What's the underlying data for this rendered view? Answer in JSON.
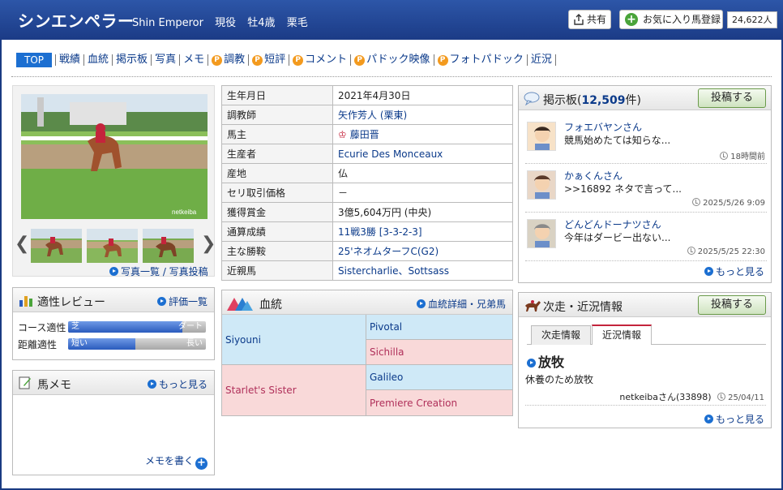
{
  "header": {
    "name": "シンエンペラー",
    "english_name": "Shin Emperor",
    "status": "現役",
    "sex_age": "牡4歳",
    "color": "栗毛",
    "share_label": "共有",
    "favorite_label": "お気に入り馬登録",
    "favorite_count": "24,622人"
  },
  "nav": {
    "top": "TOP",
    "items": [
      "戦績",
      "血統",
      "掲示板",
      "写真",
      "メモ",
      "調教",
      "短評",
      "コメント",
      "パドック映像",
      "フォトパドック",
      "近況"
    ],
    "premium_flags": [
      false,
      false,
      false,
      false,
      false,
      true,
      true,
      true,
      true,
      true,
      false
    ],
    "premium_mark": "P"
  },
  "photos": {
    "watermark": "netkeiba",
    "list_link": "写真一覧 / 写真投稿"
  },
  "aptitude": {
    "title": "適性レビュー",
    "link": "評価一覧",
    "rows": [
      {
        "label": "コース適性",
        "left": "芝",
        "right": "ダート",
        "value": 0.83
      },
      {
        "label": "距離適性",
        "left": "短い",
        "right": "長い",
        "value": 0.49
      }
    ]
  },
  "memo": {
    "title": "馬メモ",
    "link": "もっと見る",
    "write": "メモを書く"
  },
  "profile": [
    {
      "key": "生年月日",
      "value": "2021年4月30日",
      "link": false
    },
    {
      "key": "調教師",
      "value": "矢作芳人 (栗東)",
      "link": true
    },
    {
      "key": "馬主",
      "value": "藤田晋",
      "link": true
    },
    {
      "key": "生産者",
      "value": "Ecurie Des Monceaux",
      "link": true
    },
    {
      "key": "産地",
      "value": "仏",
      "link": false
    },
    {
      "key": "セリ取引価格",
      "value": "－",
      "link": false
    },
    {
      "key": "獲得賞金",
      "value": "3億5,604万円 (中央)",
      "link": false
    },
    {
      "key": "通算成績",
      "value": "11戦3勝 [3-3-2-3]",
      "link": true
    },
    {
      "key": "主な勝鞍",
      "value": "25'ネオムターフC(G2)",
      "link": true
    },
    {
      "key": "近親馬",
      "value": "Sistercharlie、Sottsass",
      "link": true
    }
  ],
  "pedigree": {
    "title": "血統",
    "link": "血統詳細・兄弟馬",
    "sire": "Siyouni",
    "dam": "Starlet's Sister",
    "sire_sire": "Pivotal",
    "sire_dam": "Sichilla",
    "dam_sire": "Galileo",
    "dam_dam": "Premiere Creation"
  },
  "bbs": {
    "title": "掲示板",
    "count_open": "(",
    "count": "12,509",
    "count_suffix": "件)",
    "post_button": "投稿する",
    "more": "もっと見る",
    "posts": [
      {
        "user": "フォエバヤンさん",
        "text": "競馬始めたては知らな...",
        "time": "18時間前"
      },
      {
        "user": "かぁくんさん",
        "text": ">>16892 ネタで言って...",
        "time": "2025/5/26 9:09"
      },
      {
        "user": "どんどんドーナツさん",
        "text": "今年はダービー出ない...",
        "time": "2025/5/25 22:30"
      }
    ]
  },
  "next_race": {
    "title": "次走・近況情報",
    "post_button": "投稿する",
    "tabs": [
      "次走情報",
      "近況情報"
    ],
    "active_tab": 1,
    "status_title": "放牧",
    "status_text": "休養のため放牧",
    "author": "netkeibaさん(33898)",
    "date": "25/04/11",
    "more": "もっと見る"
  }
}
